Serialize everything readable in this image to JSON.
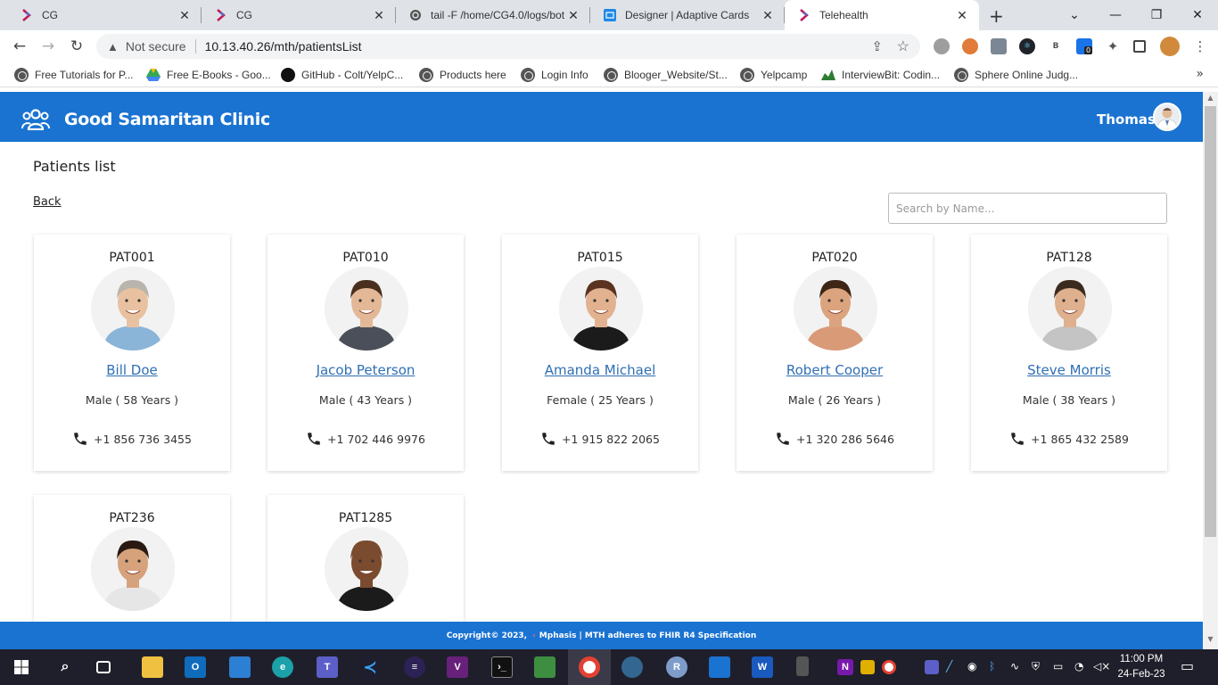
{
  "browser": {
    "tabs": [
      {
        "title": "CG",
        "icon": "cg-logo-icon"
      },
      {
        "title": "CG",
        "icon": "cg-logo-icon"
      },
      {
        "title": "tail -F /home/CG4.0/logs/bot",
        "icon": "globe-icon"
      },
      {
        "title": "Designer | Adaptive Cards",
        "icon": "adaptive-cards-icon"
      },
      {
        "title": "Telehealth",
        "icon": "cg-logo-icon",
        "active": true
      }
    ],
    "security_label": "Not secure",
    "url": "10.13.40.26/mth/patientsList",
    "bookmarks": [
      "Free Tutorials for P...",
      "Free E-Books - Goo...",
      "GitHub - Colt/YelpC...",
      "Products here",
      "Login Info",
      "Blooger_Website/St...",
      "Yelpcamp",
      "InterviewBit: Codin...",
      "Sphere Online Judg..."
    ],
    "extension_badge": "0",
    "ext_b_label": "B"
  },
  "app": {
    "title": "Good Samaritan Clinic",
    "user_name": "Thomas",
    "page_title": "Patients list",
    "back_label": "Back",
    "search_placeholder": "Search by Name...",
    "patients": [
      {
        "id": "PAT001",
        "name": "Bill Doe",
        "gender_age": "Male ( 58 Years )",
        "phone": "+1 856 736 3455",
        "skin": "#e8c2a0",
        "hair": "#b9b4ac",
        "shirt": "#8ab4d8"
      },
      {
        "id": "PAT010",
        "name": "Jacob Peterson",
        "gender_age": "Male ( 43 Years )",
        "phone": "+1 702 446 9976",
        "skin": "#e3b896",
        "hair": "#4a2f1e",
        "shirt": "#4a4f5a"
      },
      {
        "id": "PAT015",
        "name": "Amanda Michael",
        "gender_age": "Female ( 25 Years )",
        "phone": "+1 915 822 2065",
        "skin": "#e2b290",
        "hair": "#5a3420",
        "shirt": "#1b1b1b"
      },
      {
        "id": "PAT020",
        "name": "Robert Cooper",
        "gender_age": "Male ( 26 Years )",
        "phone": "+1 320 286 5646",
        "skin": "#dba37e",
        "hair": "#3e2616",
        "shirt": "#d99a78"
      },
      {
        "id": "PAT128",
        "name": "Steve Morris",
        "gender_age": "Male ( 38 Years )",
        "phone": "+1 865 432 2589",
        "skin": "#deb08e",
        "hair": "#3b2a1e",
        "shirt": "#c4c4c4"
      },
      {
        "id": "PAT236",
        "name": "",
        "gender_age": "",
        "phone": "",
        "skin": "#d6a27c",
        "hair": "#2a1a12",
        "shirt": "#e6e6e6"
      },
      {
        "id": "PAT1285",
        "name": "",
        "gender_age": "",
        "phone": "",
        "skin": "#7a4b2e",
        "hair": "#7a4b2e",
        "shirt": "#1b1b1b"
      }
    ],
    "footer": {
      "copyright": "Copyright© 2023,",
      "company": "Mphasis",
      "statement": "| MTH adheres to FHIR R4 Specification"
    },
    "colors": {
      "primary": "#1a73d1",
      "link": "#2f6fb3"
    }
  },
  "taskbar": {
    "time": "11:00 PM",
    "date": "24-Feb-23"
  }
}
